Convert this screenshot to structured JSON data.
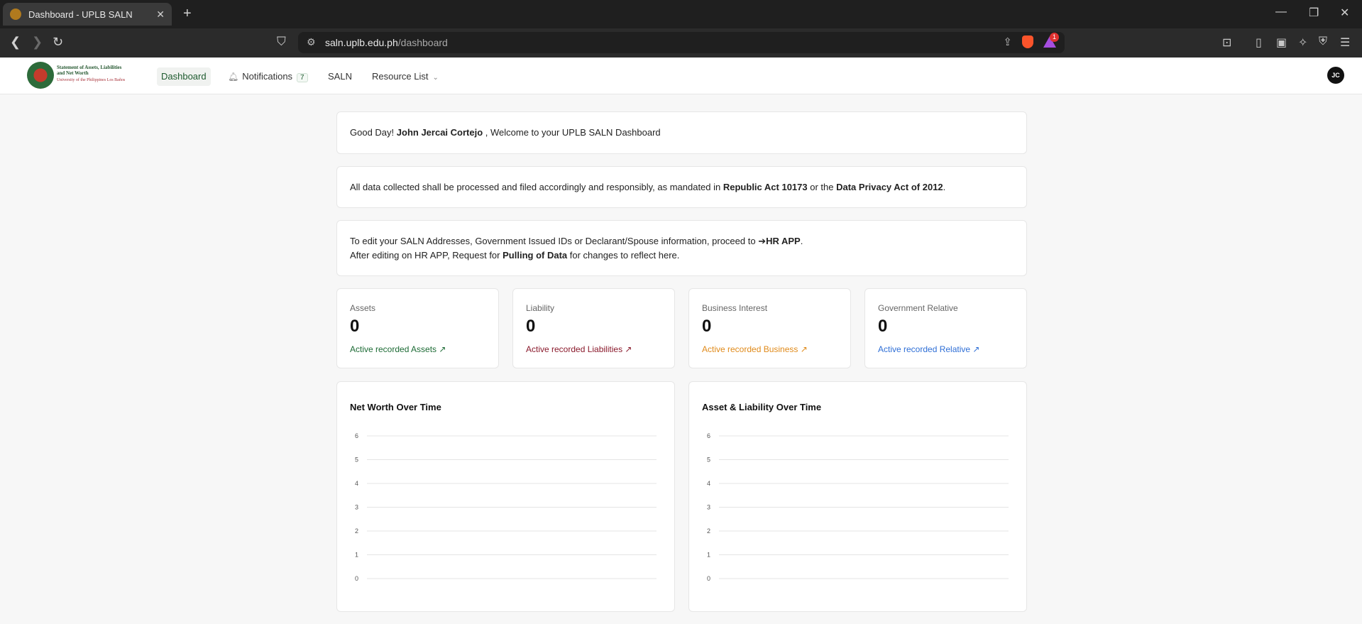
{
  "browser": {
    "tab_title": "Dashboard - UPLB SALN",
    "url_host": "saln.uplb.edu.ph",
    "url_path": "/dashboard",
    "rewards_badge": "1"
  },
  "header": {
    "logo_line1": "Statement of Assets, Liabilities and Net Worth",
    "logo_line2": "University of the Philippines Los Baños",
    "nav": {
      "dashboard": "Dashboard",
      "notifications": "Notifications",
      "notifications_count": "7",
      "saln": "SALN",
      "resource_list": "Resource List"
    },
    "avatar_initials": "JC"
  },
  "greeting": {
    "prefix": "Good Day!",
    "name": "John Jercai Cortejo",
    "suffix": ", Welcome to your UPLB SALN Dashboard"
  },
  "privacy": {
    "text1": "All data collected shall be processed and filed accordingly and responsibly, as mandated in",
    "act1": "Republic Act 10173",
    "or": "or the",
    "act2": "Data Privacy Act of 2012",
    "end": "."
  },
  "hr_notice": {
    "line1_prefix": "To edit your SALN Addresses, Government Issued IDs or Declarant/Spouse information, proceed to",
    "hr_link": "➔HR APP",
    "line1_end": ".",
    "line2_prefix": "After editing on HR APP, Request for",
    "pulling": "Pulling of Data",
    "line2_suffix": "for changes to reflect here."
  },
  "stats": [
    {
      "label": "Assets",
      "value": "0",
      "footer": "Active recorded Assets",
      "color": "#1d6b35"
    },
    {
      "label": "Liability",
      "value": "0",
      "footer": "Active recorded Liabilities",
      "color": "#8a1a2c"
    },
    {
      "label": "Business Interest",
      "value": "0",
      "footer": "Active recorded Business",
      "color": "#e08a1a"
    },
    {
      "label": "Government Relative",
      "value": "0",
      "footer": "Active recorded Relative",
      "color": "#2f6fd6"
    }
  ],
  "chart_data": [
    {
      "type": "line",
      "title": "Net Worth Over Time",
      "x": [],
      "series": [],
      "ylim": [
        0,
        6
      ],
      "yticks": [
        "0",
        "1",
        "2",
        "3",
        "4",
        "5",
        "6"
      ],
      "grid": true
    },
    {
      "type": "line",
      "title": "Asset & Liability Over Time",
      "x": [],
      "series": [],
      "ylim": [
        0,
        6
      ],
      "yticks": [
        "0",
        "1",
        "2",
        "3",
        "4",
        "5",
        "6"
      ],
      "grid": true
    }
  ]
}
